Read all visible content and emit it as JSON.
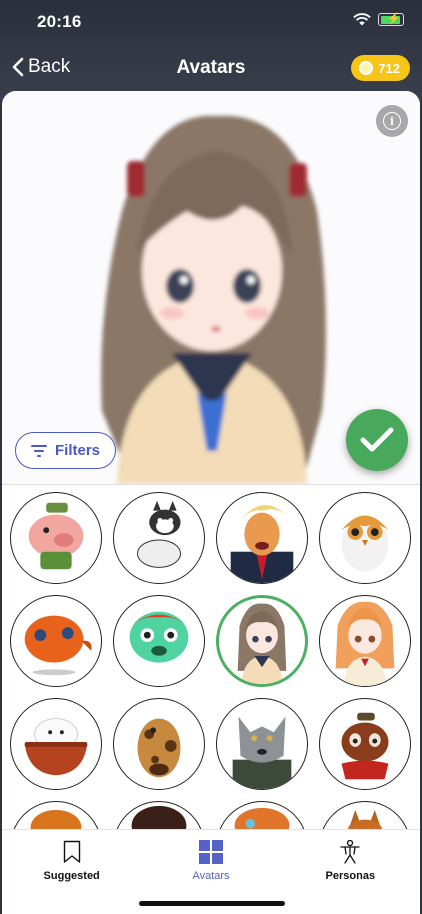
{
  "status": {
    "time": "20:16"
  },
  "nav": {
    "back_label": "Back",
    "title": "Avatars",
    "coins": "712"
  },
  "preview": {
    "filters_label": "Filters",
    "info_label": "i"
  },
  "avatars": [
    {
      "name": "pig",
      "selected": false
    },
    {
      "name": "husky-puppy",
      "selected": false
    },
    {
      "name": "politician",
      "selected": false
    },
    {
      "name": "owl",
      "selected": false
    },
    {
      "name": "orange-fish",
      "selected": false
    },
    {
      "name": "green-fish",
      "selected": false
    },
    {
      "name": "anime-girl-brown-hair",
      "selected": true
    },
    {
      "name": "anime-girl-orange-hair",
      "selected": false
    },
    {
      "name": "puppy-in-bowl",
      "selected": false
    },
    {
      "name": "giraffe",
      "selected": false
    },
    {
      "name": "wolf",
      "selected": false
    },
    {
      "name": "red-panda",
      "selected": false
    },
    {
      "name": "pumpkin",
      "selected": false
    },
    {
      "name": "dark-creature",
      "selected": false
    },
    {
      "name": "orange-creature",
      "selected": false
    },
    {
      "name": "fox",
      "selected": false
    }
  ],
  "tabs": [
    {
      "label": "Suggested",
      "icon": "bookmark-icon",
      "active": false
    },
    {
      "label": "Avatars",
      "icon": "grid-icon",
      "active": true
    },
    {
      "label": "Personas",
      "icon": "person-icon",
      "active": false
    }
  ],
  "colors": {
    "accent": "#4a59c4",
    "confirm": "#48a85c",
    "coin_badge": "#f5c518",
    "selected_ring": "#4caf62"
  }
}
